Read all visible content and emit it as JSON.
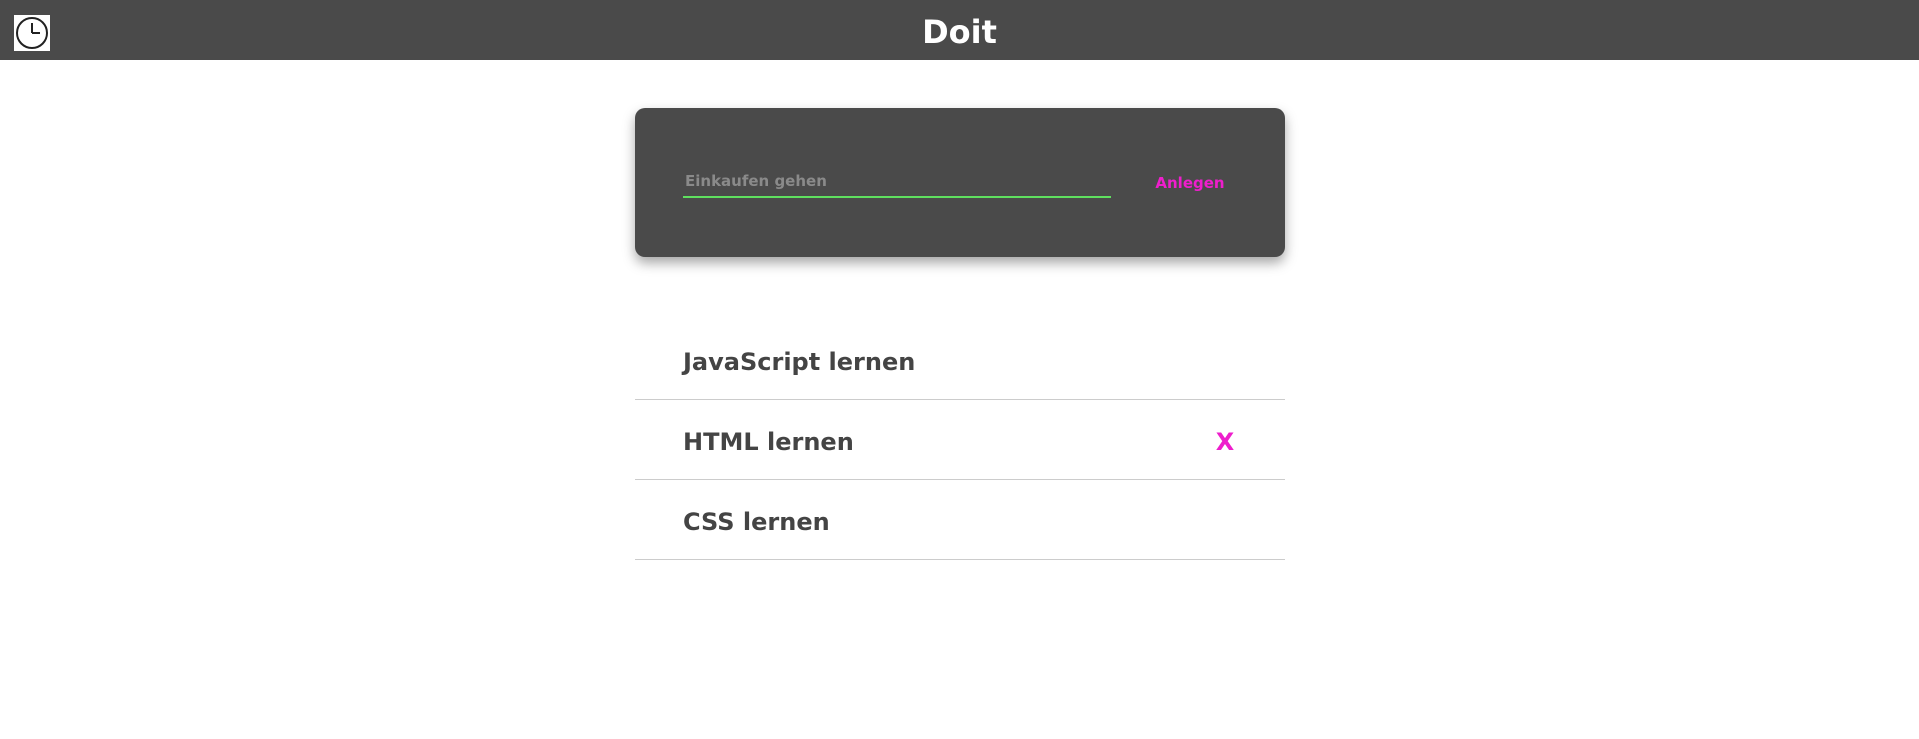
{
  "header": {
    "title": "Doit",
    "icon": "clock-icon"
  },
  "new_task": {
    "placeholder": "Einkaufen gehen",
    "value": "",
    "add_label": "Anlegen",
    "underline_color": "#5fe05f",
    "accent_color": "#ee1ecc"
  },
  "todos": [
    {
      "text": "JavaScript lernen"
    },
    {
      "text": "HTML lernen",
      "delete_label": "X"
    },
    {
      "text": "CSS lernen"
    }
  ],
  "colors": {
    "header_bg": "#4a4a4a",
    "card_bg": "#4a4a4a",
    "text": "#444444",
    "divider": "#cccccc"
  }
}
